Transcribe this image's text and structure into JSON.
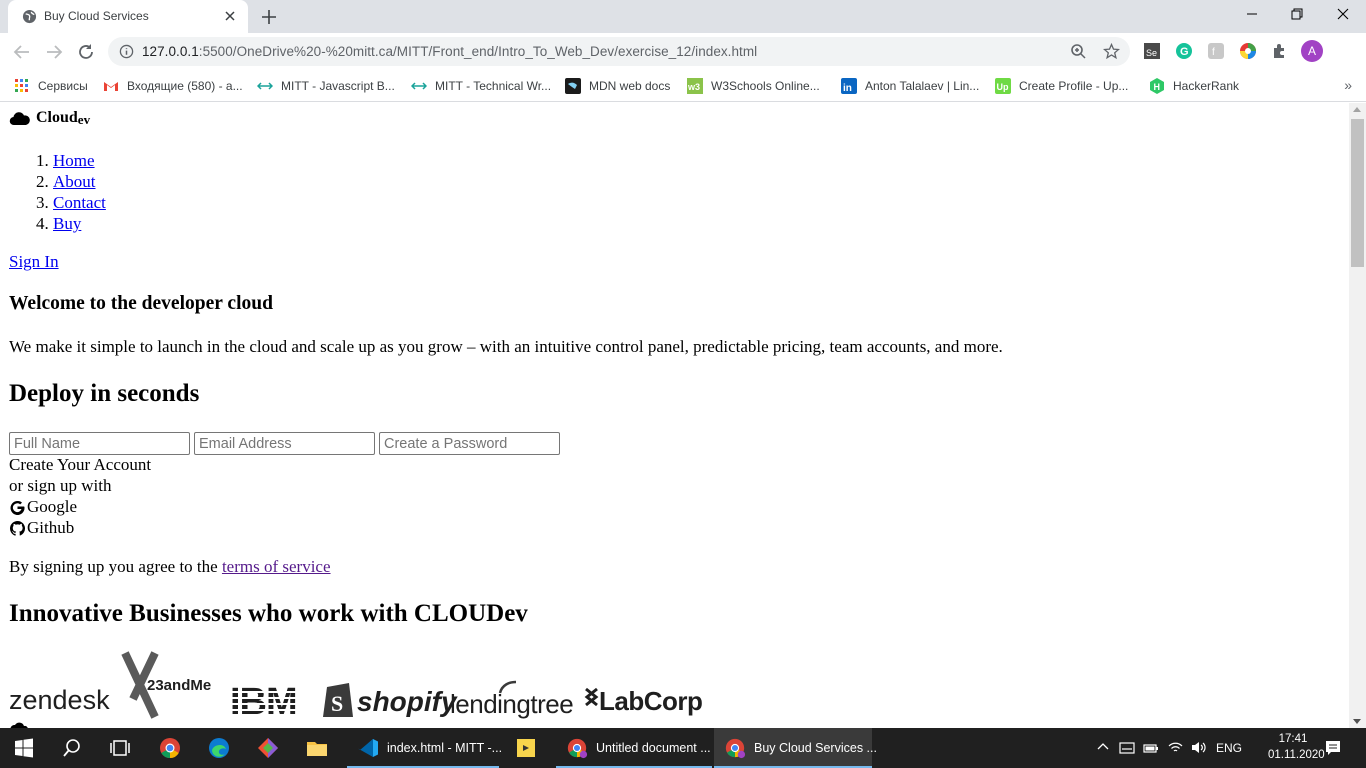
{
  "browser": {
    "tab_title": "Buy Cloud Services",
    "url_host": "127.0.0.1",
    "url_path": ":5500/OneDrive%20-%20mitt.ca/MITT/Front_end/Intro_To_Web_Dev/exercise_12/index.html",
    "avatar_letter": "A",
    "bookmarks": [
      {
        "label": "Сервисы",
        "icon": "apps-grid-icon"
      },
      {
        "label": "Входящие (580) - a...",
        "icon": "gmail-icon"
      },
      {
        "label": "MITT - Javascript B...",
        "icon": "link-icon"
      },
      {
        "label": "MITT - Technical Wr...",
        "icon": "link-icon"
      },
      {
        "label": "MDN web docs",
        "icon": "mdn-icon"
      },
      {
        "label": "W3Schools Online...",
        "icon": "w3schools-icon"
      },
      {
        "label": "Anton Talalaev | Lin...",
        "icon": "linkedin-icon"
      },
      {
        "label": "Create Profile - Up...",
        "icon": "upwork-icon"
      },
      {
        "label": "HackerRank",
        "icon": "hackerrank-icon"
      }
    ]
  },
  "page": {
    "logo_text": "Cloud",
    "logo_sub": "ev",
    "nav": [
      "Home",
      "About",
      "Contact",
      "Buy"
    ],
    "sign_in": "Sign In",
    "welcome_heading": "Welcome to the developer cloud",
    "intro": "We make it simple to launch in the cloud and scale up as you grow – with an intuitive control panel, predictable pricing, team accounts, and more.",
    "deploy_heading": "Deploy in seconds",
    "form": {
      "full_name_placeholder": "Full Name",
      "email_placeholder": "Email Address",
      "password_placeholder": "Create a Password",
      "create_account": "Create Your Account",
      "or_sign_up": "or sign up with",
      "google": "Google",
      "github": "Github"
    },
    "terms_prefix": "By signing up you agree to the ",
    "terms_link": "terms of service",
    "biz_heading": "Innovative Businesses who work with CLOUDev",
    "partner_logos": [
      "zendesk",
      "23andMe",
      "IBM",
      "shopify",
      "lendingtree",
      "LabCorp"
    ]
  },
  "taskbar": {
    "apps": [
      {
        "label": "index.html - MITT -...",
        "icon": "vscode-icon"
      },
      {
        "label": "Untitled document ...",
        "icon": "chrome-icon"
      },
      {
        "label": "Buy Cloud Services ...",
        "icon": "chrome-icon"
      }
    ],
    "language": "ENG",
    "time": "17:41",
    "date": "01.11.2020"
  },
  "colors": {
    "link": "#0000ee",
    "visited_link": "#551a8b",
    "taskbar_bg": "#202020",
    "accent": "#76b9ed"
  }
}
